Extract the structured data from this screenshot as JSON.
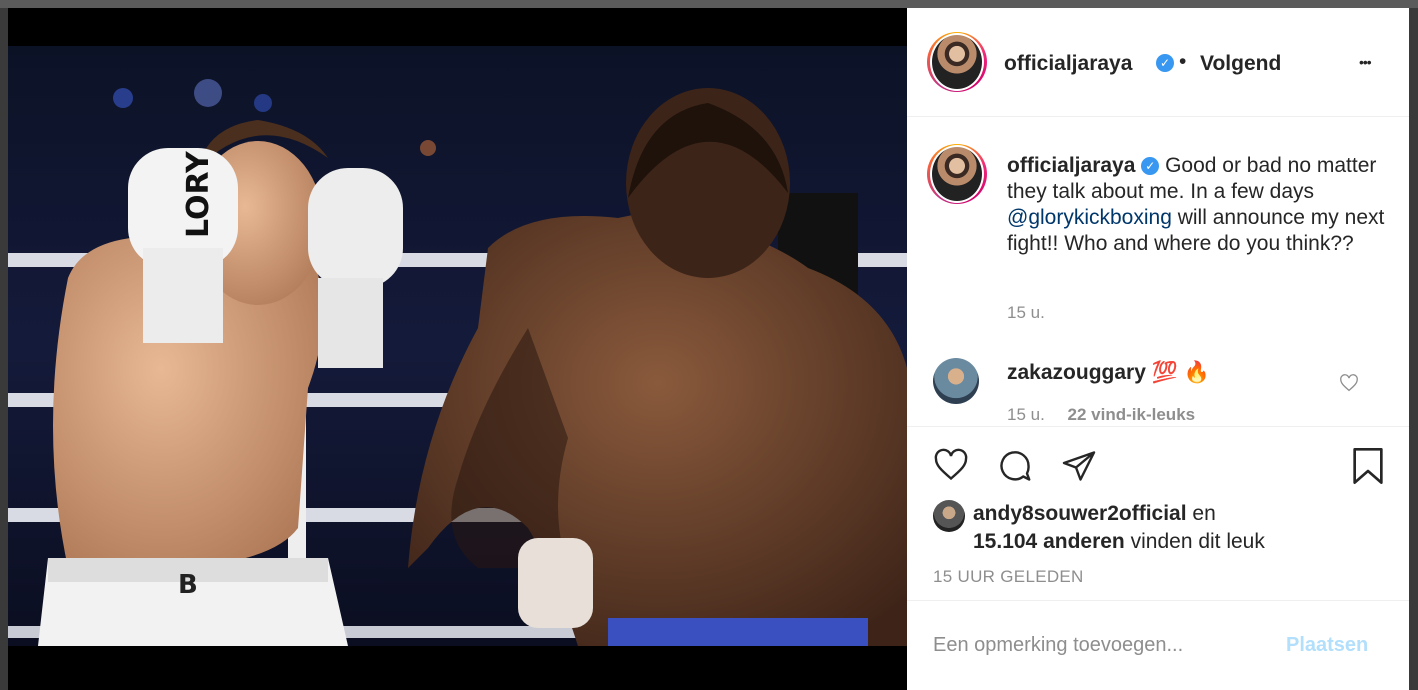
{
  "post": {
    "author": "officialjaraya",
    "follow_status": "Volgend",
    "dot": "•",
    "more": "•••",
    "caption_before": " Good or bad no matter they talk about me. In a few days ",
    "caption_mention": "@glorykickboxing",
    "caption_after": " will announce my next fight!! Who and where do you think??",
    "caption_time": "15 u."
  },
  "comment": {
    "author": "zakazouggary",
    "emoji_1": "💯",
    "emoji_2": "🔥",
    "time": "15 u.",
    "likes": "22 vind-ik-leuks"
  },
  "likes": {
    "liker": "andy8souwer2official",
    "and": "en",
    "others": "15.104 anderen",
    "suffix": "vinden dit leuk"
  },
  "timestamp": "15 UUR GELEDEN",
  "comment_box": {
    "placeholder": "Een opmerking toevoegen...",
    "post_label": "Plaatsen"
  },
  "photo_text": {
    "glove_brand": "LORY",
    "shorts_logo": "B"
  },
  "colors": {
    "link": "#00376b",
    "post_disabled": "#b2dffc",
    "verified": "#3897f0"
  }
}
